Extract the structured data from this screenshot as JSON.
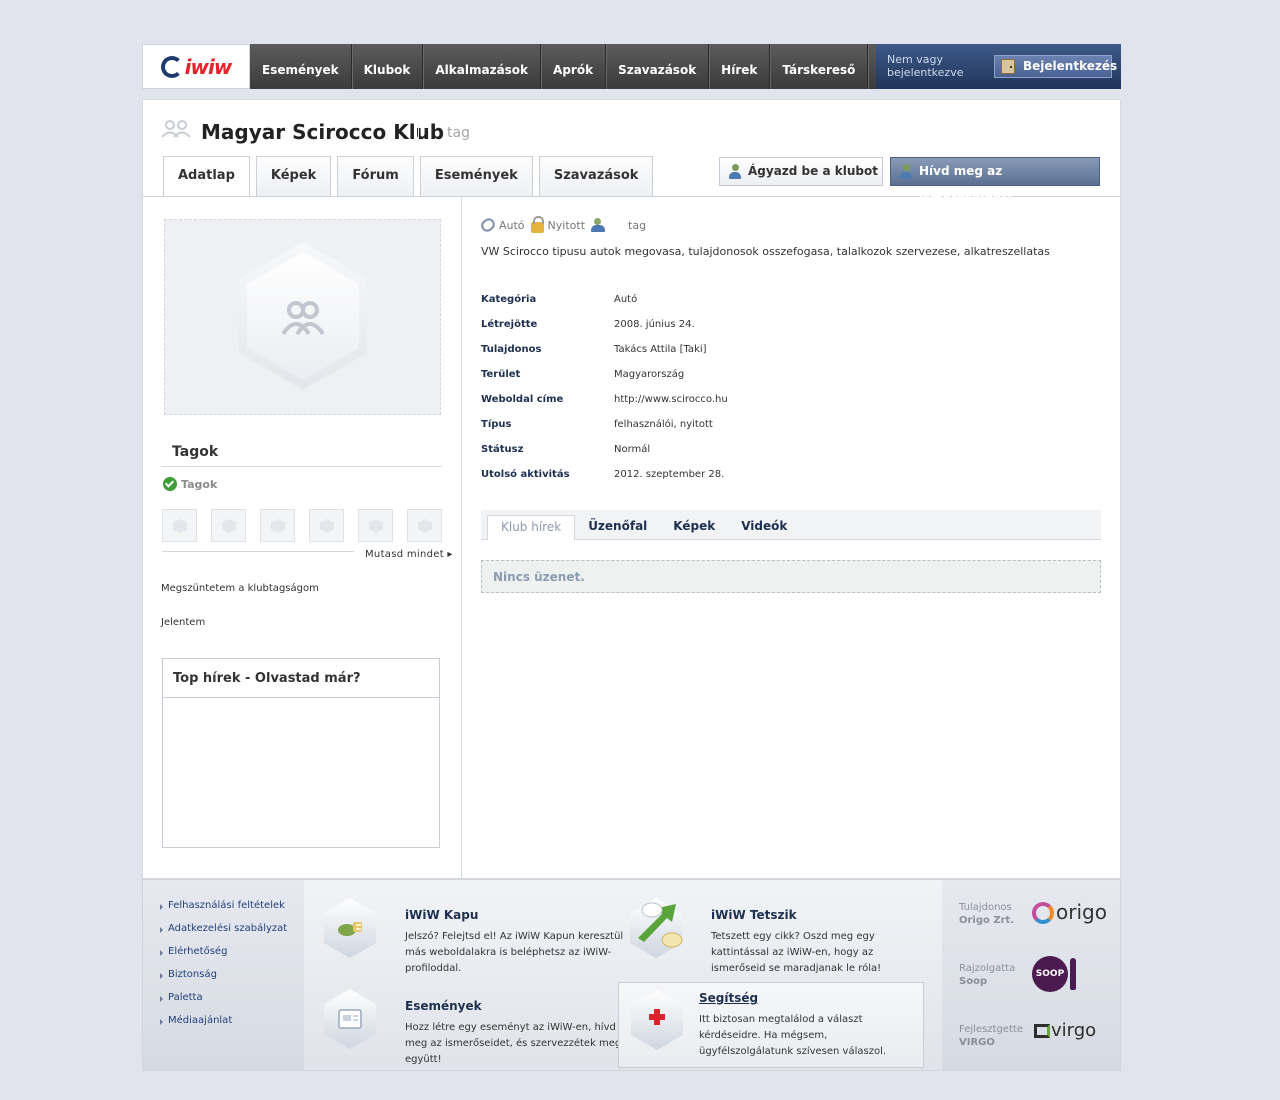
{
  "nav": {
    "logo_text": "iwiw",
    "items": [
      "Események",
      "Klubok",
      "Alkalmazások",
      "Aprók",
      "Szavazások",
      "Hírek",
      "Társkereső"
    ],
    "login_status": "Nem vagy bejelentkezve",
    "login_button": "Bejelentkezés"
  },
  "club": {
    "title": "Magyar Scirocco Klub",
    "tag": "tag",
    "tabs": [
      "Adatlap",
      "Képek",
      "Fórum",
      "Események",
      "Szavazások"
    ],
    "active_tab": "Adatlap",
    "invite_button": "Ágyazd be a klubot",
    "invite_friends_button": "Hívd meg az ismerőseidet!"
  },
  "sidebar": {
    "members_title": "Tagok",
    "members_label": "Tagok",
    "show_all": "Mutasd mindet ▸",
    "leave_link": "Megszüntetem a klubtagságom",
    "report_link": "Jelentem",
    "top_news_title": "Top hírek - Olvastad már?"
  },
  "details": {
    "meta": {
      "category": "Autó",
      "openness": "Nyitott",
      "tag": "tag"
    },
    "description": "VW Scirocco tipusu autok megovasa, tulajdonosok osszefogasa, talalkozok szervezese, alkatreszellatas",
    "rows": [
      {
        "label": "Kategória",
        "value": "Autó"
      },
      {
        "label": "Létrejötte",
        "value": "2008. június 24."
      },
      {
        "label": "Tulajdonos",
        "value": "Takács Attila [Taki]"
      },
      {
        "label": "Terület",
        "value": "Magyarország"
      },
      {
        "label": "Weboldal címe",
        "value": "http://www.scirocco.hu"
      },
      {
        "label": "Típus",
        "value": "felhasználói, nyitott"
      },
      {
        "label": "Státusz",
        "value": "Normál"
      },
      {
        "label": "Utolsó aktivitás",
        "value": "2012. szeptember 28."
      }
    ],
    "subtabs": [
      "Klub hírek",
      "Üzenőfal",
      "Képek",
      "Videók"
    ],
    "no_message": "Nincs üzenet."
  },
  "footer": {
    "links": [
      "Felhasználási feltételek",
      "Adatkezelési szabályzat",
      "Elérhetőség",
      "Biztonság",
      "Paletta",
      "Médiaajánlat"
    ],
    "promos": [
      {
        "title": "iWiW Kapu",
        "text": "Jelszó? Felejtsd el! Az iWiW Kapun keresztül más weboldalakra is beléphetsz az iWiW-profiloddal."
      },
      {
        "title": "iWiW Tetszik",
        "text": "Tetszett egy cikk? Oszd meg egy kattintással az iWiW-en, hogy az ismerőseid se maradjanak le róla!"
      },
      {
        "title": "Események",
        "text": "Hozz létre egy eseményt az iWiW-en, hívd meg az ismerőseidet, és szervezzétek meg együtt!"
      },
      {
        "title": "Segítség",
        "text": "Itt biztosan megtalálod a választ kérdéseidre. Ha mégsem, ügyfélszolgálatunk szívesen válaszol."
      }
    ],
    "sponsors": [
      {
        "role": "Tulajdonos",
        "name": "Origo Zrt.",
        "logo": "origo"
      },
      {
        "role": "Rajzolgatta",
        "name": "Soop",
        "logo": "SOOP"
      },
      {
        "role": "Fejlesztgette",
        "name": "VIRGO",
        "logo": "virgo"
      }
    ]
  }
}
